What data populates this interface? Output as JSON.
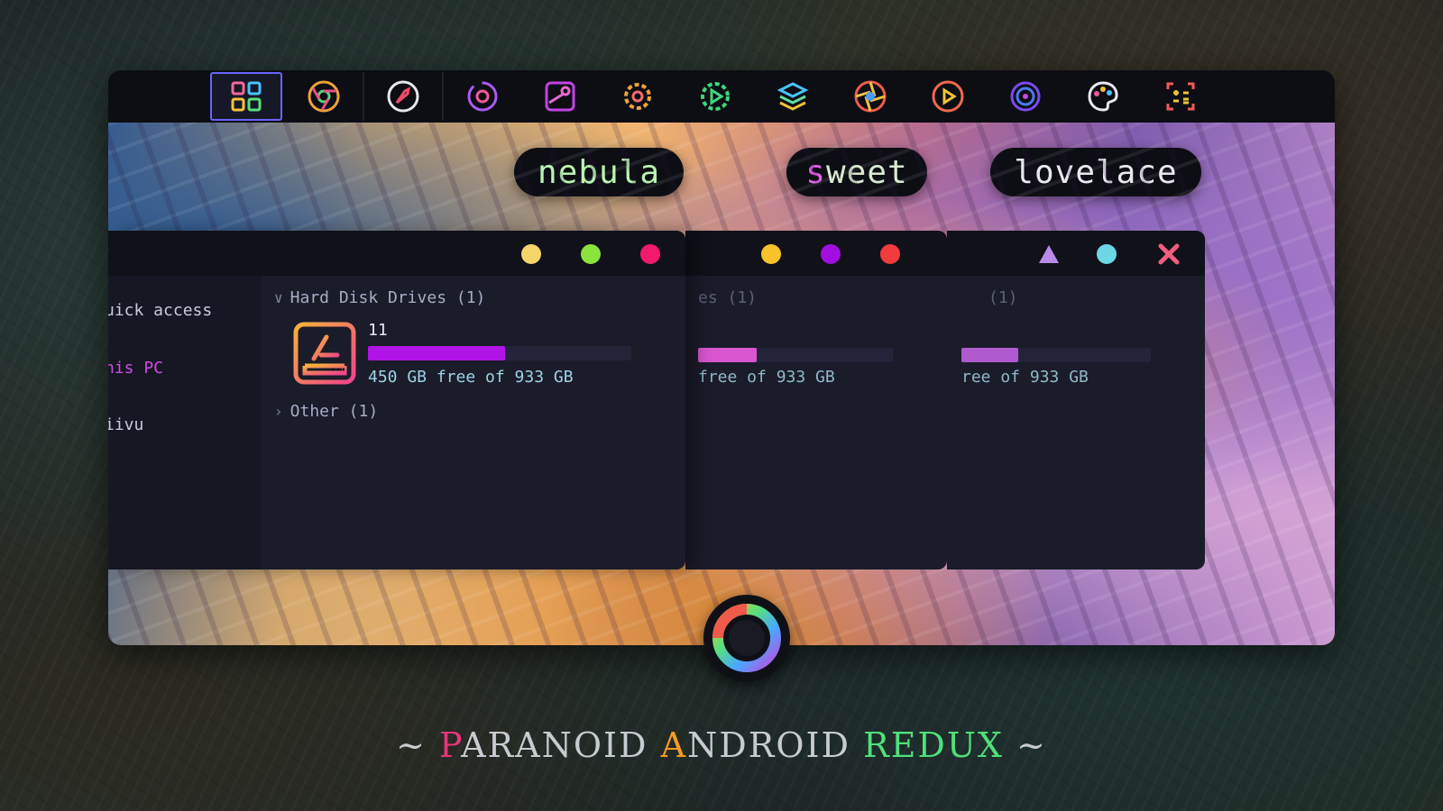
{
  "taskbar": {
    "icons": [
      {
        "name": "start-grid-icon",
        "active": true
      },
      {
        "name": "chrome-icon"
      },
      {
        "name": "compass-icon"
      },
      {
        "name": "camera-sync-icon"
      },
      {
        "name": "steam-icon"
      },
      {
        "name": "settings-gear-icon"
      },
      {
        "name": "media-gear-icon"
      },
      {
        "name": "layers-icon"
      },
      {
        "name": "aperture-icon"
      },
      {
        "name": "media-player-icon"
      },
      {
        "name": "disc-icon"
      },
      {
        "name": "palette-icon"
      },
      {
        "name": "calculator-icon"
      }
    ]
  },
  "themes": {
    "nebula": {
      "label": "nebula"
    },
    "sweet": {
      "label_first": "s",
      "label_rest": "weet"
    },
    "lovelace": {
      "label": "lovelace"
    }
  },
  "explorer": {
    "sidebar": {
      "quick_access": "uick access",
      "this_pc": "his PC",
      "user": "iivu"
    },
    "hard_disk_header": "Hard Disk Drives (1)",
    "drive": {
      "name": "11",
      "usage_fraction": 0.52,
      "free_text": "450 GB free of 933 GB"
    },
    "other_header": "Other (1)",
    "sweet_header": "es (1)",
    "sweet_free": "free of 933 GB",
    "lovelace_header": "(1)",
    "lovelace_free": "ree of 933 GB"
  },
  "colors": {
    "nebula_dots": [
      "#f5d56a",
      "#8be33d",
      "#f21a6a"
    ],
    "sweet_dots": [
      "#f7c22a",
      "#a10ee0",
      "#f03c3c"
    ],
    "lovelace_controls": [
      "#b98ae8",
      "#6cd7e6",
      "#f25d7e"
    ]
  },
  "caption": {
    "prefix": "~ ",
    "p": "P",
    "aranoid": "ARANOID ",
    "a": "A",
    "ndroid": "NDROID ",
    "redux": "REDUX",
    "suffix": " ~"
  }
}
